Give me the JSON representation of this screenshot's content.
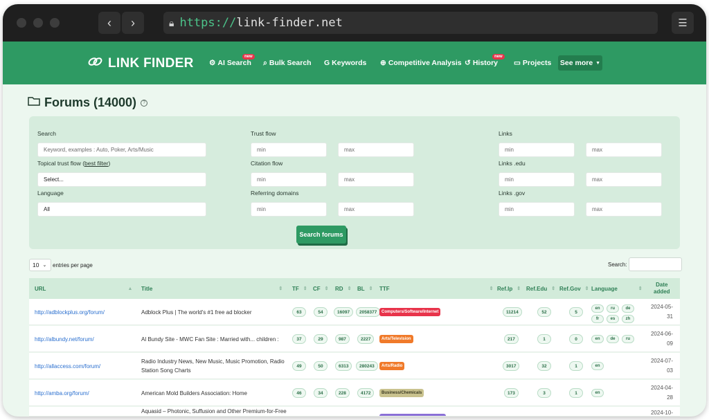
{
  "browser": {
    "url_protocol": "https://",
    "url_host": "link-finder.net"
  },
  "header": {
    "logo": "LINK FINDER",
    "nav": [
      {
        "label": "AI Search",
        "icon": "ai-chip-icon",
        "badge": "new"
      },
      {
        "label": "Bulk Search",
        "icon": "search-icon",
        "badge": ""
      },
      {
        "label": "Keywords",
        "icon": "google-g-icon",
        "badge": ""
      },
      {
        "label": "Competitive Analysis",
        "icon": "target-icon",
        "badge": ""
      },
      {
        "label": "History",
        "icon": "history-icon",
        "badge": "new"
      },
      {
        "label": "Projects",
        "icon": "folder-icon",
        "badge": ""
      }
    ],
    "see_more": "See more"
  },
  "page": {
    "title": "Forums (14000)"
  },
  "filters": {
    "search_label": "Search",
    "search_placeholder": "Keyword, examples : Auto, Poker, Arts/Music",
    "topical_label": "Topical trust flow",
    "topical_link": "best filter",
    "topical_value": "Select...",
    "language_label": "Language",
    "language_value": "All",
    "trust_flow_label": "Trust flow",
    "citation_flow_label": "Citation flow",
    "referring_domains_label": "Referring domains",
    "links_label": "Links",
    "links_edu_label": "Links .edu",
    "links_gov_label": "Links .gov",
    "min": "min",
    "max": "max",
    "search_button": "Search forums"
  },
  "table_controls": {
    "page_length": "10",
    "entries_label": "entries per page",
    "search_label": "Search:"
  },
  "table": {
    "headers": {
      "url": "URL",
      "title": "Title",
      "tf": "TF",
      "cf": "CF",
      "rd": "RD",
      "bl": "BL",
      "ttf": "TTF",
      "refip": "Ref.Ip",
      "refedu": "Ref.Edu",
      "refgov": "Ref.Gov",
      "language": "Language",
      "date_line1": "Date",
      "date_line2": "added"
    },
    "rows": [
      {
        "url": "http://adblockplus.org/forum/",
        "title": "Adblock Plus | The world's #1 free ad blocker",
        "tf": "63",
        "cf": "54",
        "rd": "16097",
        "bl": "2058377",
        "ttf": "Computers/Software/Internet",
        "ttf_color": "#e8334a",
        "refip": "11214",
        "refedu": "52",
        "refgov": "5",
        "langs": [
          "en",
          "ru",
          "de",
          "fr",
          "es",
          "zh"
        ],
        "date1": "2024-05-",
        "date2": "31"
      },
      {
        "url": "http://albundy.net/forum/",
        "title": "Al Bundy Site - MWC Fan Site : Married with... children :",
        "tf": "37",
        "cf": "29",
        "rd": "987",
        "bl": "2227",
        "ttf": "Arts/Television",
        "ttf_color": "#f07a2a",
        "refip": "217",
        "refedu": "1",
        "refgov": "0",
        "langs": [
          "en",
          "de",
          "ru"
        ],
        "date1": "2024-06-",
        "date2": "09"
      },
      {
        "url": "http://allaccess.com/forum/",
        "title": "Radio Industry News, New Music, Music Promotion, Radio Station Song Charts",
        "tf": "49",
        "cf": "50",
        "rd": "6313",
        "bl": "280243",
        "ttf": "Arts/Radio",
        "ttf_color": "#f07a2a",
        "refip": "3017",
        "refedu": "32",
        "refgov": "1",
        "langs": [
          "en"
        ],
        "date1": "2024-07-",
        "date2": "03"
      },
      {
        "url": "http://amba.org/forum/",
        "title": "American Mold Builders Association: Home",
        "tf": "46",
        "cf": "34",
        "rd": "228",
        "bl": "4172",
        "ttf": "Business/Chemicals",
        "ttf_color": "#c9c28e",
        "refip": "173",
        "refedu": "3",
        "refgov": "1",
        "langs": [
          "en"
        ],
        "date1": "2024-04-",
        "date2": "28"
      }
    ],
    "partial_row_title": "Aquasid – Photonic, Suffusion and Other Premium-for-Free",
    "partial_row_date": "2024-10-"
  }
}
